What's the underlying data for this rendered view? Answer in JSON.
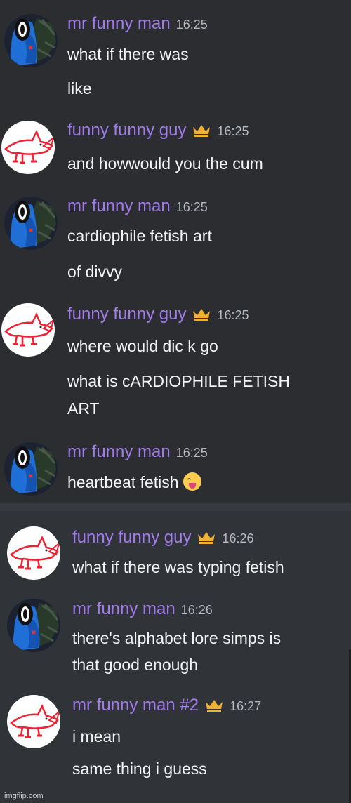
{
  "messages": [
    {
      "author": "mr funny man",
      "time": "16:25",
      "crown": false,
      "avatar": "blue-character-avatar",
      "lines": [
        "what if there was",
        "like"
      ]
    },
    {
      "author": "funny funny guy",
      "time": "16:25",
      "crown": true,
      "avatar": "shark-avatar",
      "lines": [
        "and howwould you the cum"
      ]
    },
    {
      "author": "mr funny man",
      "time": "16:25",
      "crown": false,
      "avatar": "blue-character-avatar",
      "lines": [
        "cardiophile fetish art",
        "of divvy"
      ]
    },
    {
      "author": "funny funny guy",
      "time": "16:25",
      "crown": true,
      "avatar": "shark-avatar",
      "lines": [
        "where would dic   k go",
        "what is cARDIOPHILE FETISH",
        "ART"
      ]
    },
    {
      "author": "mr funny man",
      "time": "16:25",
      "crown": false,
      "avatar": "blue-character-avatar",
      "lines": [
        "heartbeat fetish"
      ],
      "emoji": "squinting-face-with-tongue-emoji"
    },
    {
      "author": "funny funny guy",
      "time": "16:26",
      "crown": true,
      "avatar": "shark-avatar",
      "lines": [
        "what if there was typing fetish"
      ]
    },
    {
      "author": "mr funny man",
      "time": "16:26",
      "crown": false,
      "avatar": "blue-character-avatar",
      "lines": [
        "there's alphabet lore simps is",
        "that good enough"
      ]
    },
    {
      "author": "mr funny man #2",
      "time": "16:27",
      "crown": true,
      "avatar": "shark-avatar",
      "lines": [
        "i mean",
        "same thing i guess"
      ]
    }
  ],
  "watermark": "imgflip.com",
  "colors": {
    "username": "#a17bea",
    "text": "#f2f3f5",
    "timestamp": "#b5b9bf",
    "crown": "#f0b232",
    "background": "#2b2d31"
  }
}
